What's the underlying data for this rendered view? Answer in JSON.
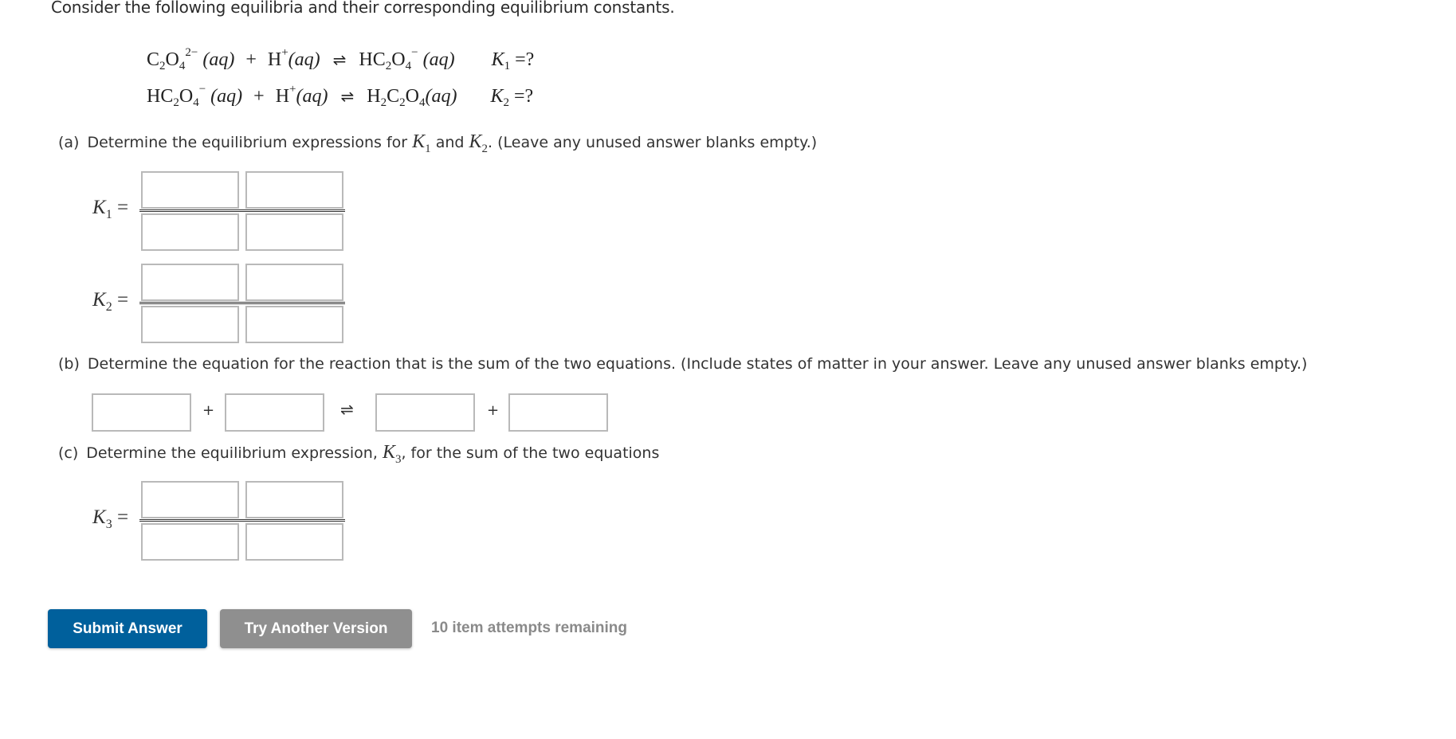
{
  "intro": "Consider the following equilibria and their corresponding equilibrium constants.",
  "equations": [
    {
      "reactant1": {
        "formula_parts": [
          "C",
          "2",
          "O",
          "4"
        ],
        "charge": "2−",
        "state": "(aq)"
      },
      "reactant2": {
        "formula": "H",
        "charge": "+",
        "state": "(aq)"
      },
      "arrow": "⇌",
      "product": {
        "formula_parts": [
          "HC",
          "2",
          "O",
          "4"
        ],
        "charge": "−",
        "state": "(aq)"
      },
      "constant": {
        "symbol": "K",
        "sub": "1",
        "value": "=?"
      }
    },
    {
      "reactant1": {
        "formula_parts": [
          "HC",
          "2",
          "O",
          "4"
        ],
        "charge": "−",
        "state": "(aq)"
      },
      "reactant2": {
        "formula": "H",
        "charge": "+",
        "state": "(aq)"
      },
      "arrow": "⇌",
      "product": {
        "formula_parts": [
          "H",
          "2",
          "C",
          "2",
          "O",
          "4"
        ],
        "state": "(aq)"
      },
      "constant": {
        "symbol": "K",
        "sub": "2",
        "value": "=?"
      }
    }
  ],
  "plus": "+",
  "part_a": {
    "tag": "(a)",
    "text_before": "Determine the equilibrium expressions for ",
    "k1": {
      "symbol": "K",
      "sub": "1"
    },
    "text_mid": " and ",
    "k2": {
      "symbol": "K",
      "sub": "2"
    },
    "text_after": ". (Leave any unused answer blanks empty.)",
    "expressions": [
      {
        "symbol": "K",
        "sub": "1",
        "eq": "=",
        "numerator": [
          "",
          ""
        ],
        "denominator": [
          "",
          ""
        ]
      },
      {
        "symbol": "K",
        "sub": "2",
        "eq": "=",
        "numerator": [
          "",
          ""
        ],
        "denominator": [
          "",
          ""
        ]
      }
    ]
  },
  "part_b": {
    "tag": "(b)",
    "text": "Determine the equation for the reaction that is the sum of the two equations. (Include states of matter in your answer. Leave any unused answer blanks empty.)",
    "reactants": [
      "",
      ""
    ],
    "products": [
      "",
      ""
    ],
    "plus": "+",
    "arrow": "⇌"
  },
  "part_c": {
    "tag": "(c)",
    "text_before": "Determine the equilibrium expression, ",
    "k3": {
      "symbol": "K",
      "sub": "3"
    },
    "text_after": ", for the sum of the two equations",
    "expression": {
      "symbol": "K",
      "sub": "3",
      "eq": "=",
      "numerator": [
        "",
        ""
      ],
      "denominator": [
        "",
        ""
      ]
    }
  },
  "actions": {
    "submit_label": "Submit Answer",
    "try_label": "Try Another Version",
    "attempts_text": "10 item attempts remaining"
  },
  "colors": {
    "submit": "#00609C",
    "try": "#8f8f8f",
    "attempts": "#8a8a8a"
  }
}
